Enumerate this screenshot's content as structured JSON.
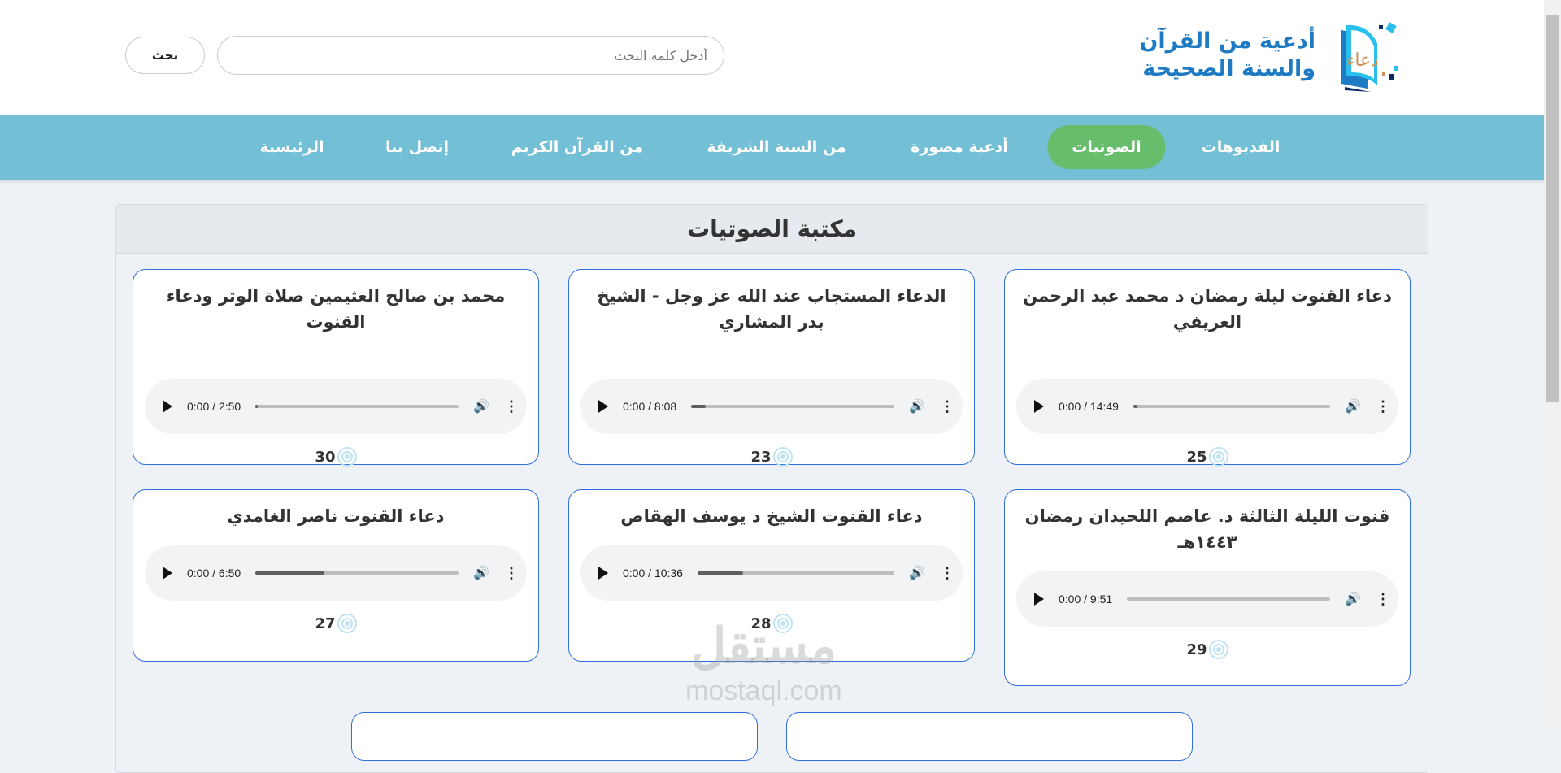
{
  "header": {
    "search_button": "بحث",
    "search_placeholder": "أدخل كلمة البحث",
    "logo_line1": "أدعية من القرآن",
    "logo_line2": "والسنة الصحيحة",
    "logo_mark": "دعاء"
  },
  "nav": [
    {
      "label": "الفديوهات"
    },
    {
      "label": "الصوتيات",
      "active": true
    },
    {
      "label": "أدعية مصورة"
    },
    {
      "label": "من السنة الشريفة"
    },
    {
      "label": "من القرآن الكريم"
    },
    {
      "label": "إتصل بنا"
    },
    {
      "label": "الرئيسية"
    }
  ],
  "panel": {
    "title": "مكتبة الصوتيات"
  },
  "cards": [
    {
      "title": "دعاء القنوت ليلة رمضان د محمد عبد الرحمن العريفي",
      "time": "0:00 / 14:49",
      "buffered": 0.02,
      "count": "25"
    },
    {
      "title": "الدعاء المستجاب عند الله عز وجل - الشيخ بدر المشاري",
      "time": "0:00 / 8:08",
      "buffered": 0.07,
      "count": "23"
    },
    {
      "title": "محمد بن صالح العثيمين صلاة الوتر ودعاء القنوت",
      "time": "0:00 / 2:50",
      "buffered": 0.01,
      "count": "30"
    },
    {
      "title": "قنوت الليلة الثالثة د. عاصم اللحيدان رمضان ١٤٤٣هـ",
      "time": "0:00 / 9:51",
      "buffered": 0.0,
      "count": "29"
    },
    {
      "title": "دعاء القنوت الشيخ د يوسف الهقاص",
      "time": "0:00 / 10:36",
      "buffered": 0.23,
      "count": "28"
    },
    {
      "title": "دعاء القنوت ناصر الغامدي",
      "time": "0:00 / 6:50",
      "buffered": 0.34,
      "count": "27"
    }
  ],
  "watermark": {
    "arabic": "مستقل",
    "latin": "mostaql.com"
  }
}
